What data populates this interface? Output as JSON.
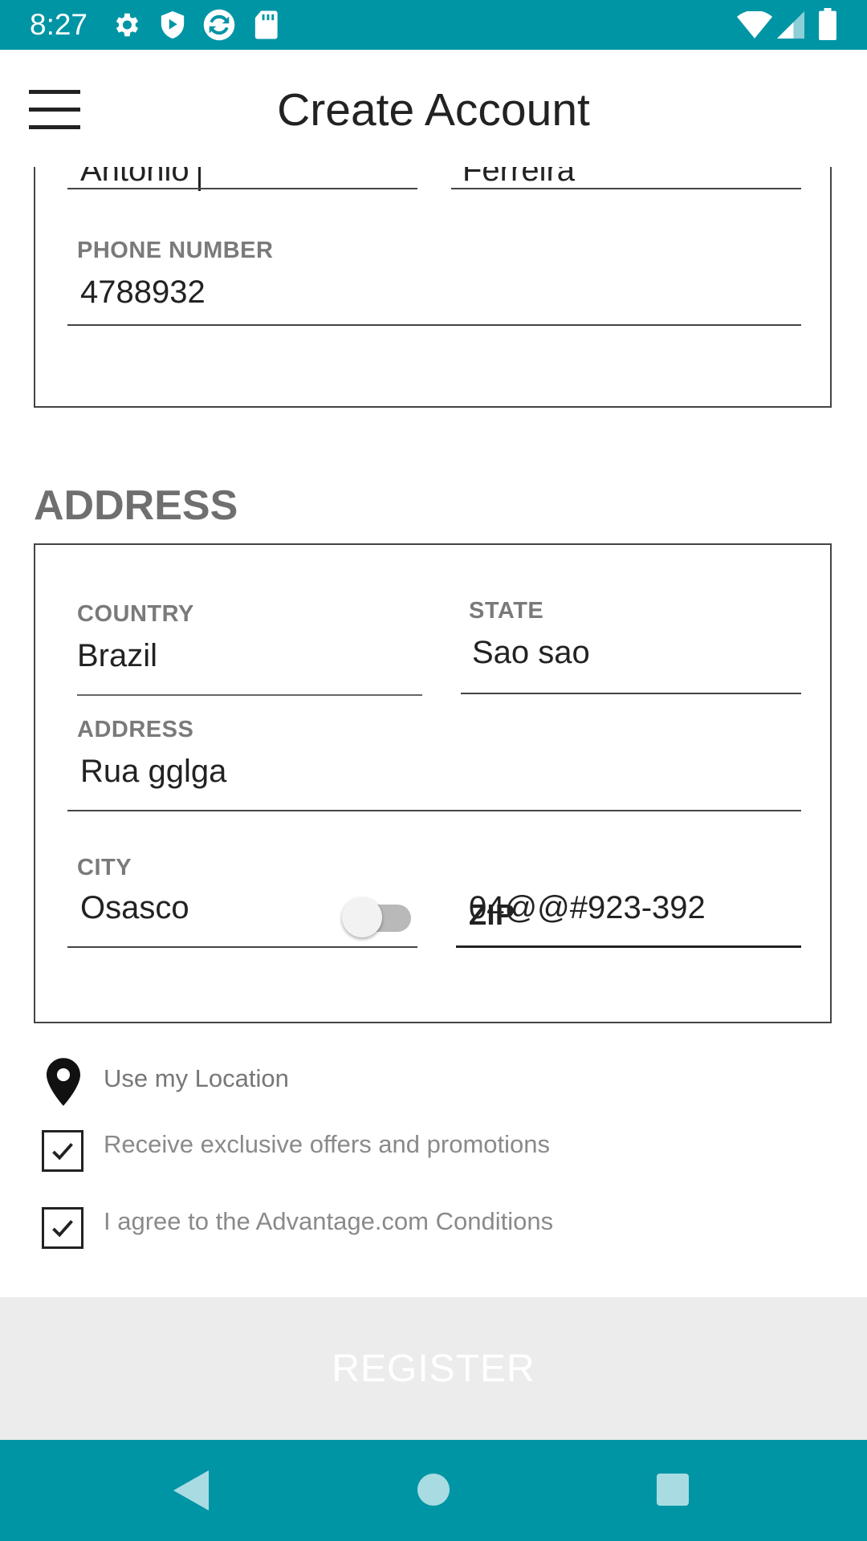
{
  "status_bar": {
    "time": "8:27",
    "icons": [
      "gear-icon",
      "shield-icon",
      "sync-icon",
      "sd-card-icon",
      "wifi-icon",
      "signal-icon",
      "battery-icon"
    ],
    "color": "#0095a5"
  },
  "app_bar": {
    "title": "Create Account",
    "menu_icon": "hamburger-menu-icon"
  },
  "personal": {
    "first_name_value": "Antonio",
    "last_name_value": "Ferreira",
    "phone_label": "PHONE NUMBER",
    "phone_value": "4788932"
  },
  "address_section": {
    "title": "ADDRESS",
    "country_label": "COUNTRY",
    "country_value": "Brazil",
    "state_label": "STATE",
    "state_value": "Sao sao",
    "address_label": "ADDRESS",
    "address_value": "Rua gglga",
    "city_label": "CITY",
    "city_value": "Osasco",
    "zip_label": "ZIP",
    "zip_value": "04@@#923-392"
  },
  "options": {
    "location_label": "Use my Location",
    "location_enabled": false,
    "offers_label": "Receive exclusive offers and promotions",
    "offers_checked": true,
    "agree_label": "I agree to the Advantage.com Conditions",
    "agree_checked": true
  },
  "register_button": "REGISTER",
  "nav_bar": {
    "back_icon": "back-triangle-icon",
    "home_icon": "home-circle-icon",
    "recents_icon": "recents-square-icon",
    "color": "#0095a5"
  }
}
